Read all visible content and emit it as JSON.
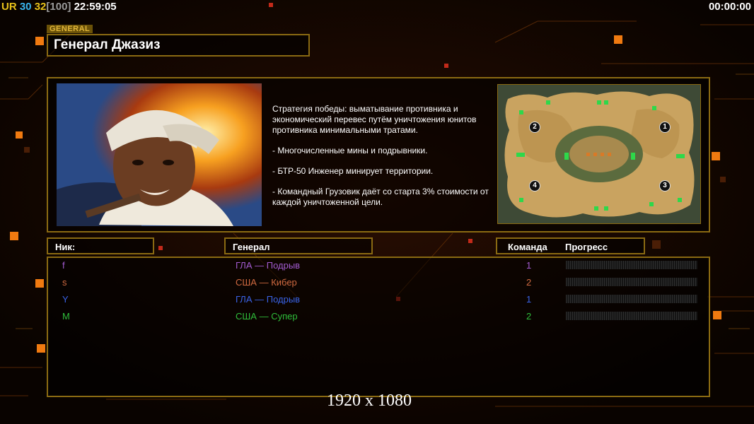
{
  "hud": {
    "ur": "UR",
    "fps": "30",
    "cap": "32",
    "cap_max": "[100]",
    "clock": "22:59:05",
    "timer": "00:00:00"
  },
  "general": {
    "tag": "GENERAL",
    "name": "Генерал Джазиз",
    "description": [
      "Стратегия победы: выматывание противника и экономический перевес путём уничтожения юнитов противника минимальными тратами.",
      "- Многочисленные мины и подрывники.",
      "- БТР-50 Инженер минирует территории.",
      "- Командный Грузовик даёт со старта 3% стоимости от каждой уничтоженной цели."
    ]
  },
  "map": {
    "spawns": [
      "1",
      "2",
      "3",
      "4"
    ]
  },
  "table": {
    "headers": {
      "nick": "Ник:",
      "general": "Генерал",
      "team": "Команда",
      "progress": "Прогресс"
    },
    "rows": [
      {
        "nick": "f",
        "general": "ГЛА — Подрыв",
        "team": "1",
        "progress": 0,
        "color": "#a35bd0"
      },
      {
        "nick": "s",
        "general": "США — Кибер",
        "team": "2",
        "progress": 0,
        "color": "#d06a40"
      },
      {
        "nick": "Y",
        "general": "ГЛА — Подрыв",
        "team": "1",
        "progress": 0,
        "color": "#3a63e6"
      },
      {
        "nick": "M",
        "general": "США — Супер",
        "team": "2",
        "progress": 0,
        "color": "#2fbd3a"
      }
    ]
  },
  "resolution": "1920 x 1080",
  "colors": {
    "accent": "#f07a10",
    "frame": "#8a6a12",
    "ur": "#e8c21a",
    "fps": "#3ab7f0",
    "cap": "#e8c21a",
    "cap_max": "#9a9a9a"
  }
}
